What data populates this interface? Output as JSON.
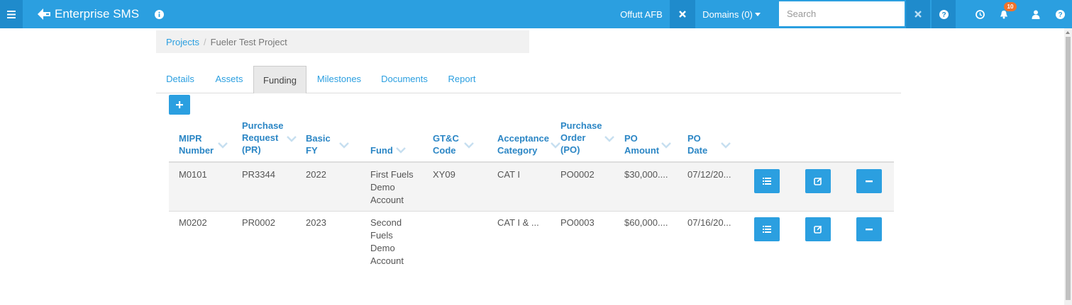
{
  "topbar": {
    "app_name": "Enterprise SMS",
    "site": "Offutt AFB",
    "domains_label": "Domains (0)",
    "search_placeholder": "Search",
    "notification_count": "10"
  },
  "breadcrumb": {
    "parent": "Projects",
    "separator": "/",
    "current": "Fueler Test Project"
  },
  "tabs": [
    {
      "label": "Details",
      "active": false
    },
    {
      "label": "Assets",
      "active": false
    },
    {
      "label": "Funding",
      "active": true
    },
    {
      "label": "Milestones",
      "active": false
    },
    {
      "label": "Documents",
      "active": false
    },
    {
      "label": "Report",
      "active": false
    }
  ],
  "table": {
    "columns": [
      [
        "MIPR",
        "Number"
      ],
      [
        "Purchase",
        "Request",
        "(PR)"
      ],
      [
        "Basic",
        "FY"
      ],
      [
        "Fund"
      ],
      [
        "GT&C",
        "Code"
      ],
      [
        "Acceptance",
        "Category"
      ],
      [
        "Purchase",
        "Order",
        "(PO)"
      ],
      [
        "PO",
        "Amount"
      ],
      [
        "PO",
        "Date"
      ]
    ],
    "rows": [
      {
        "mipr": "M0101",
        "pr": "PR3344",
        "fy": "2022",
        "fund": [
          "First Fuels",
          "Demo",
          "Account"
        ],
        "gtc": "XY09",
        "category": "CAT I",
        "po": "PO0002",
        "amount": "$30,000....",
        "date": "07/12/20..."
      },
      {
        "mipr": "M0202",
        "pr": "PR0002",
        "fy": "2023",
        "fund": [
          "Second",
          "Fuels",
          "Demo",
          "Account"
        ],
        "gtc": "",
        "category": "CAT I & ...",
        "po": "PO0003",
        "amount": "$60,000....",
        "date": "07/16/20..."
      }
    ]
  },
  "icons": {
    "menu": "hamburger-icon",
    "brand": "arrow-logo-icon",
    "info": "info-icon",
    "clear_site": "close-icon",
    "clear_search": "close-icon",
    "help": "help-icon",
    "history": "clock-icon",
    "notifications": "bell-icon",
    "user": "user-icon",
    "add": "plus-icon",
    "row_actions": [
      "list-icon",
      "edit-icon",
      "minus-icon"
    ]
  },
  "colors": {
    "topbar": "#2b9fe0",
    "accent": "#2b9fe0",
    "header_text": "#2b86c5",
    "badge": "#f0732a"
  }
}
